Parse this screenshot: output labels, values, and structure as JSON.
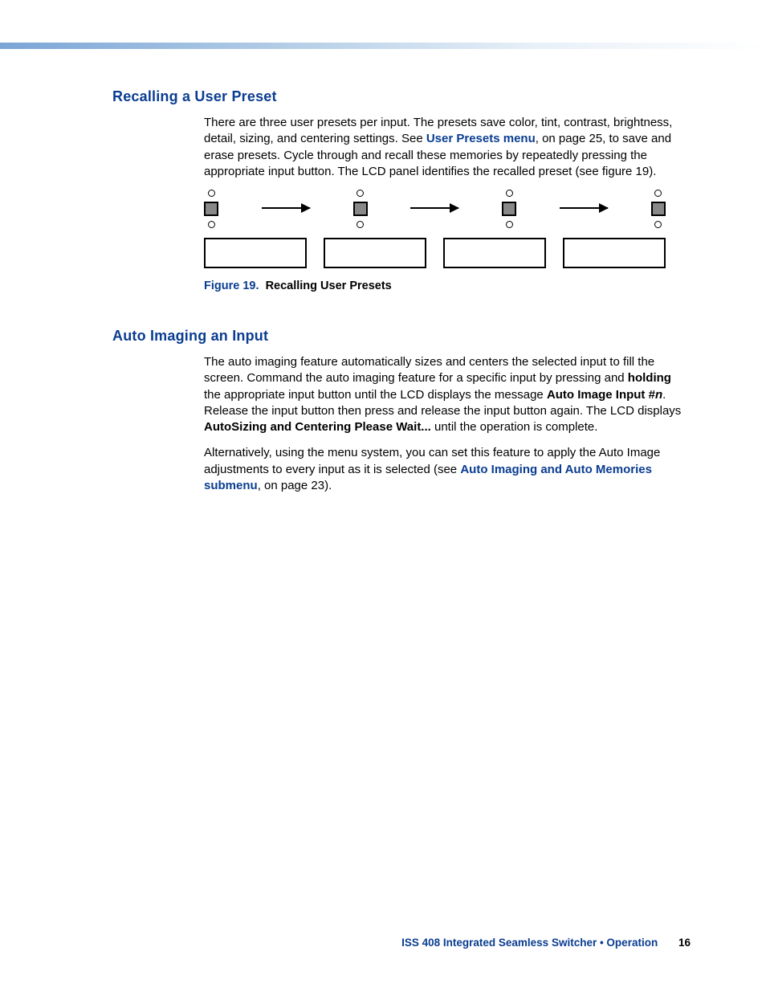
{
  "section1": {
    "heading": "Recalling a User Preset",
    "para1_a": "There are three user presets per input. The presets save color, tint, contrast, brightness, detail, sizing, and centering settings. See ",
    "para1_link": "User Presets menu",
    "para1_b": ", on page 25, to save and erase presets. Cycle through and recall these memories by repeatedly pressing the appropriate input button. The LCD panel identifies the recalled preset (see figure 19).",
    "figure_label": "Figure 19.",
    "figure_title": "Recalling User Presets"
  },
  "section2": {
    "heading": "Auto Imaging an Input",
    "para1_a": "The auto imaging feature automatically sizes and centers the selected input to fill the screen. Command the auto imaging feature for a specific input by pressing and ",
    "para1_hold": "holding",
    "para1_b": " the appropriate input button until the LCD displays the message ",
    "para1_msg_a": "Auto Image Input #",
    "para1_msg_n": "n",
    "para1_c": ". Release the input button then press and release the input button again. The LCD displays ",
    "para1_autosize": "AutoSizing and Centering Please Wait...",
    "para1_d": " until the operation is complete.",
    "para2_a": "Alternatively, using the menu system, you can set this feature to apply the Auto Image adjustments to every input as it is selected (see ",
    "para2_link": "Auto Imaging and Auto Memories submenu",
    "para2_b": ", on page 23)."
  },
  "footer": {
    "text": "ISS 408 Integrated Seamless Switcher • Operation",
    "page": "16"
  }
}
